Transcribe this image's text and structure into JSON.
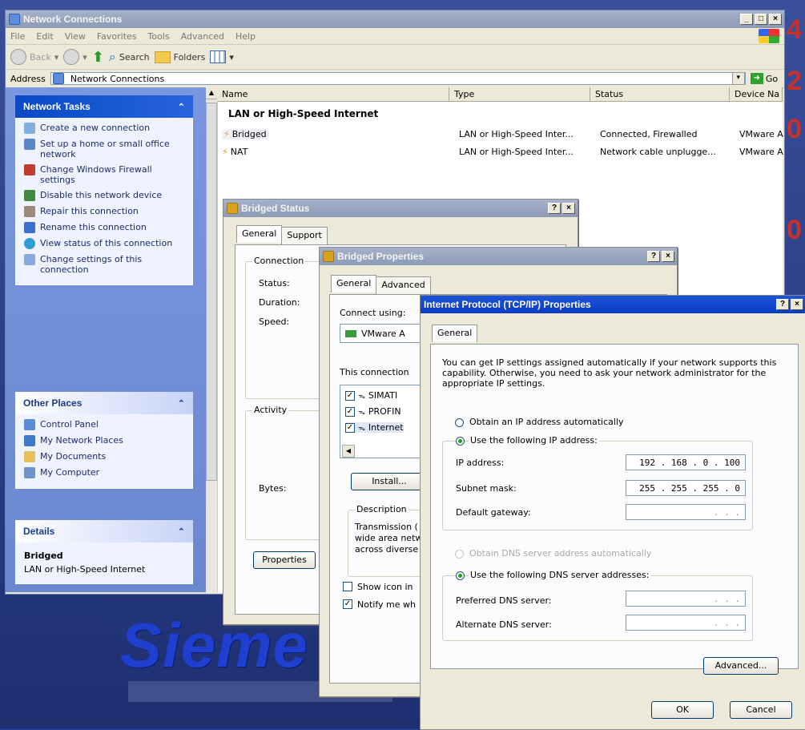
{
  "explorer": {
    "title": "Network Connections",
    "menu": [
      "File",
      "Edit",
      "View",
      "Favorites",
      "Tools",
      "Advanced",
      "Help"
    ],
    "toolbar": {
      "back": "Back",
      "search": "Search",
      "folders": "Folders"
    },
    "address_label": "Address",
    "address_value": "Network Connections",
    "go_label": "Go"
  },
  "taskpane": {
    "network_tasks": {
      "title": "Network Tasks",
      "items": [
        "Create a new connection",
        "Set up a home or small office network",
        "Change Windows Firewall settings",
        "Disable this network device",
        "Repair this connection",
        "Rename this connection",
        "View status of this connection",
        "Change settings of this connection"
      ]
    },
    "other_places": {
      "title": "Other Places",
      "items": [
        "Control Panel",
        "My Network Places",
        "My Documents",
        "My Computer"
      ]
    },
    "details": {
      "title": "Details",
      "name": "Bridged",
      "type": "LAN or High-Speed Internet"
    }
  },
  "list": {
    "columns": [
      "Name",
      "Type",
      "Status",
      "Device Na"
    ],
    "group": "LAN or High-Speed Internet",
    "rows": [
      {
        "name": "Bridged",
        "type": "LAN or High-Speed Inter...",
        "status": "Connected, Firewalled",
        "device": "VMware A"
      },
      {
        "name": "NAT",
        "type": "LAN or High-Speed Inter...",
        "status": "Network cable unplugge...",
        "device": "VMware A"
      }
    ]
  },
  "status_dialog": {
    "title": "Bridged Status",
    "tabs": [
      "General",
      "Support"
    ],
    "connection_group": "Connection",
    "labels": [
      "Status:",
      "Duration:",
      "Speed:"
    ],
    "activity_group": "Activity",
    "bytes_label": "Bytes:",
    "properties_button": "Properties"
  },
  "props_dialog": {
    "title": "Bridged Properties",
    "tabs": [
      "General",
      "Advanced"
    ],
    "connect_using": "Connect using:",
    "adapter": "VMware A",
    "this_connection": "This connection",
    "components": [
      "SIMATI",
      "PROFIN",
      "Internet"
    ],
    "install_button": "Install...",
    "description_group": "Description",
    "description_text": [
      "Transmission (",
      "wide area netw",
      "across diverse"
    ],
    "show_icon": "Show icon in",
    "notify": "Notify me wh"
  },
  "tcp_dialog": {
    "title": "Internet Protocol (TCP/IP) Properties",
    "tab": "General",
    "intro": "You can get IP settings assigned automatically if your network supports this capability. Otherwise, you need to ask your network administrator for the appropriate IP settings.",
    "obtain_ip": "Obtain an IP address automatically",
    "use_ip": "Use the following IP address:",
    "ip_label": "IP address:",
    "ip_value": "192 . 168 .   0 . 100",
    "mask_label": "Subnet mask:",
    "mask_value": "255 . 255 . 255 .   0",
    "gateway_label": "Default gateway:",
    "gateway_value": ".        .        .",
    "obtain_dns": "Obtain DNS server address automatically",
    "use_dns": "Use the following DNS server addresses:",
    "preferred_label": "Preferred DNS server:",
    "preferred_value": ".        .        .",
    "alternate_label": "Alternate DNS server:",
    "alternate_value": ".        .        .",
    "advanced_button": "Advanced...",
    "ok_button": "OK",
    "cancel_button": "Cancel"
  },
  "wallpaper": {
    "brand": "Sieme"
  }
}
